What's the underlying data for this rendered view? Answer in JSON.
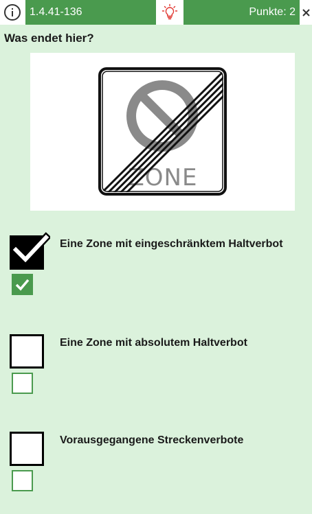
{
  "header": {
    "question_id": "1.4.41-136",
    "points_label": "Punkte: 2",
    "info_icon": "info-icon",
    "hint_icon": "lightbulb-icon",
    "close_icon": "close-icon",
    "accent_color": "#4a9a4e",
    "hint_color": "#e0322c"
  },
  "question": {
    "text": "Was endet hier?",
    "sign": {
      "icon": "end-of-no-parking-zone-sign",
      "label": "ZONE"
    }
  },
  "answers": [
    {
      "text": "Eine Zone mit eingeschränktem Haltverbot",
      "user_checked": true,
      "solution_checked": true
    },
    {
      "text": "Eine Zone mit absolutem Haltverbot",
      "user_checked": false,
      "solution_checked": false
    },
    {
      "text": "Vorausgegangene Streckenverbote",
      "user_checked": false,
      "solution_checked": false
    }
  ],
  "colors": {
    "background": "#dbf2dc",
    "correct_green": "#4a9a4e"
  }
}
